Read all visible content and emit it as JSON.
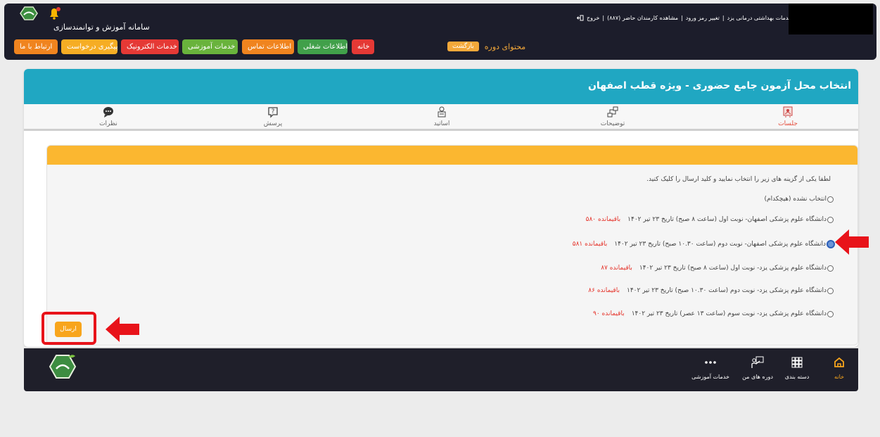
{
  "header": {
    "site_title": "سامانه آموزش و توانمندسازی",
    "user_menu": {
      "services": "خدمات بهداشتی درمانی یزد",
      "change_password": "تغییر رمز ورود",
      "attendance": "مشاهده کارمندان حاضر (۸۸۷)",
      "logout": "خروج"
    }
  },
  "nav": {
    "buttons": [
      {
        "label": "ارتباط با ما",
        "color": "#f0841f"
      },
      {
        "label": "پیگیری درخواست",
        "color": "#f6ad24"
      },
      {
        "label": "خدمات الکترونیک",
        "color": "#e53935"
      },
      {
        "label": "خدمات آموزشی",
        "color": "#69b33c"
      },
      {
        "label": "اطلاعات تماس",
        "color": "#f0841f"
      },
      {
        "label": "اطلاعات شغلی",
        "color": "#41a04a"
      },
      {
        "label": "خانه",
        "color": "#e53935"
      }
    ],
    "course_content": "محتوای دوره",
    "back": "بازگشت"
  },
  "card": {
    "title": "انتخاب محل آزمون جامع حضوری - ویژه قطب اصفهان",
    "tabs": [
      {
        "label": "جلسات",
        "icon": "sessions-icon",
        "active": true
      },
      {
        "label": "توضیحات",
        "icon": "description-icon",
        "active": false
      },
      {
        "label": "اساتید",
        "icon": "teachers-icon",
        "active": false
      },
      {
        "label": "پرسش",
        "icon": "question-icon",
        "active": false
      },
      {
        "label": "نظرات",
        "icon": "comments-icon",
        "active": false
      }
    ]
  },
  "form": {
    "instruction": "لطفا یکی از گزینه های زیر را انتخاب نمایید و کلید ارسال را کلیک کنید.",
    "options": [
      {
        "label": "انتخاب نشده (هیچکدام)",
        "remaining": "",
        "checked": false
      },
      {
        "label": "دانشگاه علوم پزشکی اصفهان- نوبت اول (ساعت ۸ صبح) تاریخ ۲۳ تیر ۱۴۰۲",
        "remaining": "باقیمانده ۵۸۰",
        "checked": false
      },
      {
        "label": "دانشگاه علوم پزشکی اصفهان- نوبت دوم (ساعت ۱۰.۳۰ صبح) تاریخ ۲۳ تیر ۱۴۰۲",
        "remaining": "باقیمانده ۵۸۱",
        "checked": true
      },
      {
        "label": "دانشگاه علوم پزشکی یزد- نوبت اول (ساعت ۸ صبح) تاریخ ۲۳ تیر ۱۴۰۲",
        "remaining": "باقیمانده ۸۷",
        "checked": false
      },
      {
        "label": "دانشگاه علوم پزشکی یزد- نوبت دوم (ساعت ۱۰.۳۰ صبح) تاریخ ۲۳ تیر ۱۴۰۲",
        "remaining": "باقیمانده ۸۶",
        "checked": false
      },
      {
        "label": "دانشگاه علوم پزشکی یزد- نوبت سوم (ساعت ۱۳ عصر) تاریخ ۲۳ تیر ۱۴۰۲",
        "remaining": "باقیمانده ۹۰",
        "checked": false
      }
    ],
    "submit": "ارسال"
  },
  "footer": {
    "items": [
      {
        "label": "خانه",
        "icon": "home-icon",
        "active": true
      },
      {
        "label": "دسته بندی",
        "icon": "grid-icon",
        "active": false
      },
      {
        "label": "دوره های من",
        "icon": "teacher-board-icon",
        "active": false
      },
      {
        "label": "خدمات آموزشی",
        "icon": "more-dots-icon",
        "active": false
      }
    ]
  },
  "colors": {
    "header_teal": "#20a7c2",
    "panel_orange": "#fbb730",
    "accent_red": "#e8131a"
  }
}
